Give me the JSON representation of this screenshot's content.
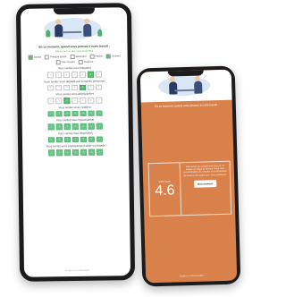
{
  "survey": {
    "title": "En ce moment, quand vous pensez à votre travail :",
    "subtitle": "Dites-nous ce que vous ressentez",
    "legend": [
      "Jamais",
      "Presque jamais",
      "Rarement",
      "Parfois",
      "Souvent",
      "Très souvent",
      "Toujours"
    ],
    "questions": [
      {
        "label": "Vous sentez-vous fatigué(e)",
        "selected": 6
      },
      {
        "label": "Vous sentez-vous dégoûté par certaines personnes",
        "selected": 5
      },
      {
        "label": "Vous sentez-vous désespéré(e)",
        "selected": 3
      },
      {
        "label": "Vous sentez-vous «vidé(e)»",
        "selected": 0
      },
      {
        "label": "Vous sentez-vous impuissant(e)",
        "selected": 0
      },
      {
        "label": "Vous sentez-vous déprimé(e)",
        "selected": 0
      },
      {
        "label": "Vous sentez-vous physiquement faible ou malade",
        "selected": 0
      }
    ],
    "scale": [
      "1",
      "2",
      "3",
      "4",
      "5",
      "6",
      "7"
    ],
    "footer": "Analyse en confidentialité"
  },
  "result": {
    "title": "En ce moment, quand vous pensez à votre travail :",
    "score_label": "Votre score",
    "score": "4.6",
    "text": "Votre score est compris entre 4,5 et 5 : il indique un risque de burnout. Nous vous recommandons de consulter un professionnel de santé et d'en parler avec votre employeur.",
    "button": "Bon moment",
    "footer": "Analyse en confidentialité"
  },
  "colors": {
    "accent_green": "#58c071",
    "result_orange": "#d9814a"
  }
}
